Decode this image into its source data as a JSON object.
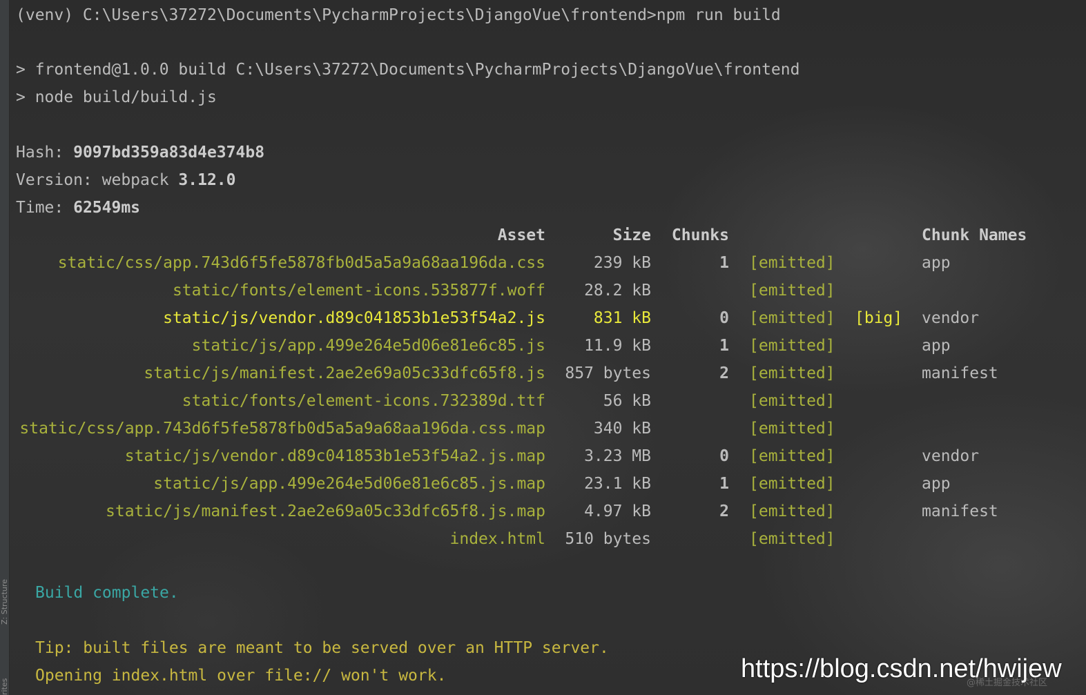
{
  "sidebar": {
    "tool_windows": [
      "Z: Structure",
      "rites"
    ]
  },
  "terminal": {
    "prompt_line": "(venv) C:\\Users\\37272\\Documents\\PycharmProjects\\DjangoVue\\frontend>npm run build",
    "script_line1": "> frontend@1.0.0 build C:\\Users\\37272\\Documents\\PycharmProjects\\DjangoVue\\frontend",
    "script_line2": "> node build/build.js",
    "hash_label": "Hash: ",
    "hash_value": "9097bd359a83d4e374b8",
    "version_label": "Version: webpack ",
    "version_value": "3.12.0",
    "time_label": "Time: ",
    "time_value": "62549ms",
    "table_headers": {
      "asset": "Asset",
      "size": "Size",
      "chunks": "Chunks",
      "chunk_names": "Chunk Names"
    },
    "assets": [
      {
        "asset": "static/css/app.743d6f5fe5878fb0d5a5a9a68aa196da.css",
        "size": "239 kB",
        "chunks": "1",
        "status": "[emitted]",
        "flag": "",
        "name": "app",
        "highlight": false
      },
      {
        "asset": "static/fonts/element-icons.535877f.woff",
        "size": "28.2 kB",
        "chunks": "",
        "status": "[emitted]",
        "flag": "",
        "name": "",
        "highlight": false
      },
      {
        "asset": "static/js/vendor.d89c041853b1e53f54a2.js",
        "size": "831 kB",
        "chunks": "0",
        "status": "[emitted]",
        "flag": "[big]",
        "name": "vendor",
        "highlight": true
      },
      {
        "asset": "static/js/app.499e264e5d06e81e6c85.js",
        "size": "11.9 kB",
        "chunks": "1",
        "status": "[emitted]",
        "flag": "",
        "name": "app",
        "highlight": false
      },
      {
        "asset": "static/js/manifest.2ae2e69a05c33dfc65f8.js",
        "size": "857 bytes",
        "chunks": "2",
        "status": "[emitted]",
        "flag": "",
        "name": "manifest",
        "highlight": false
      },
      {
        "asset": "static/fonts/element-icons.732389d.ttf",
        "size": "56 kB",
        "chunks": "",
        "status": "[emitted]",
        "flag": "",
        "name": "",
        "highlight": false
      },
      {
        "asset": "static/css/app.743d6f5fe5878fb0d5a5a9a68aa196da.css.map",
        "size": "340 kB",
        "chunks": "",
        "status": "[emitted]",
        "flag": "",
        "name": "",
        "highlight": false
      },
      {
        "asset": "static/js/vendor.d89c041853b1e53f54a2.js.map",
        "size": "3.23 MB",
        "chunks": "0",
        "status": "[emitted]",
        "flag": "",
        "name": "vendor",
        "highlight": false
      },
      {
        "asset": "static/js/app.499e264e5d06e81e6c85.js.map",
        "size": "23.1 kB",
        "chunks": "1",
        "status": "[emitted]",
        "flag": "",
        "name": "app",
        "highlight": false
      },
      {
        "asset": "static/js/manifest.2ae2e69a05c33dfc65f8.js.map",
        "size": "4.97 kB",
        "chunks": "2",
        "status": "[emitted]",
        "flag": "",
        "name": "manifest",
        "highlight": false
      },
      {
        "asset": "index.html",
        "size": "510 bytes",
        "chunks": "",
        "status": "[emitted]",
        "flag": "",
        "name": "",
        "highlight": false
      }
    ],
    "build_complete": "Build complete.",
    "tip_line1": "Tip: built files are meant to be served over an HTTP server.",
    "tip_line2": "Opening index.html over file:// won't work."
  },
  "watermark": {
    "url": "https://blog.csdn.net/hwijew",
    "small": "@稀土掘金技术社区"
  },
  "colors": {
    "background": "#2b2b2b",
    "default_text": "#bbbbbb",
    "asset_green": "#a9b23c",
    "big_yellow": "#e8e83a",
    "cyan": "#3aa7a4",
    "tip_yellow": "#c8b840"
  }
}
